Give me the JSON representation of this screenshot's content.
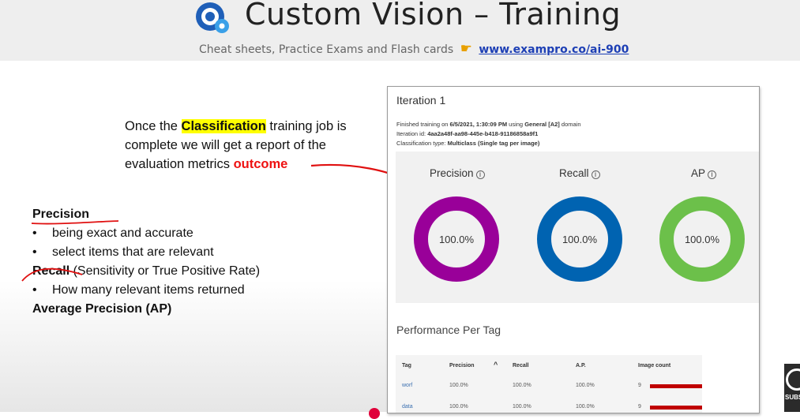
{
  "header": {
    "title": "Custom Vision – Training",
    "subtitle": "Cheat sheets, Practice Exams and Flash cards",
    "link": "www.exampro.co/ai-900",
    "logo_icon": "custom-vision-logo-icon",
    "hand_icon": "pointing-hand-icon"
  },
  "intro": {
    "pre": "Once the ",
    "highlight": "Classification",
    "mid": " training job is complete we will get a report of the evaluation metrics ",
    "outcome": "outcome"
  },
  "definitions": {
    "precision_heading": "Precision",
    "precision_bullets": [
      "being exact and accurate",
      "select items that are relevant"
    ],
    "recall_heading": "Recall",
    "recall_sub": " (Sensitivity or True Positive Rate)",
    "recall_bullet": "How many relevant items returned",
    "ap_heading": "Average Precision (AP)"
  },
  "panel": {
    "iteration_title": "Iteration 1",
    "meta_line1_pre": "Finished training on ",
    "meta_line1_date": "6/5/2021, 1:30:09 PM",
    "meta_line1_mid": " using ",
    "meta_line1_domain": "General [A2]",
    "meta_line1_post": " domain",
    "meta_line2_pre": "Iteration id: ",
    "meta_line2_id": "4aa2a48f-aa98-445e-b418-91186858a9f1",
    "meta_line3_pre": "Classification type: ",
    "meta_line3_type": "Multiclass (Single tag per image)",
    "metrics": [
      {
        "label": "Precision",
        "value": "100.0%",
        "color": "#990099"
      },
      {
        "label": "Recall",
        "value": "100.0%",
        "color": "#0063b1"
      },
      {
        "label": "AP",
        "value": "100.0%",
        "color": "#6cc04a"
      }
    ],
    "performance_title": "Performance Per Tag",
    "table": {
      "headers": [
        "Tag",
        "Precision",
        "Recall",
        "A.P.",
        "Image count"
      ],
      "sort_icon": "caret-up-icon",
      "rows": [
        {
          "tag": "worf",
          "precision": "100.0%",
          "recall": "100.0%",
          "ap": "100.0%",
          "count": "9"
        },
        {
          "tag": "data",
          "precision": "100.0%",
          "recall": "100.0%",
          "ap": "100.0%",
          "count": "9"
        }
      ]
    }
  },
  "subscribe_text": "SUBS"
}
